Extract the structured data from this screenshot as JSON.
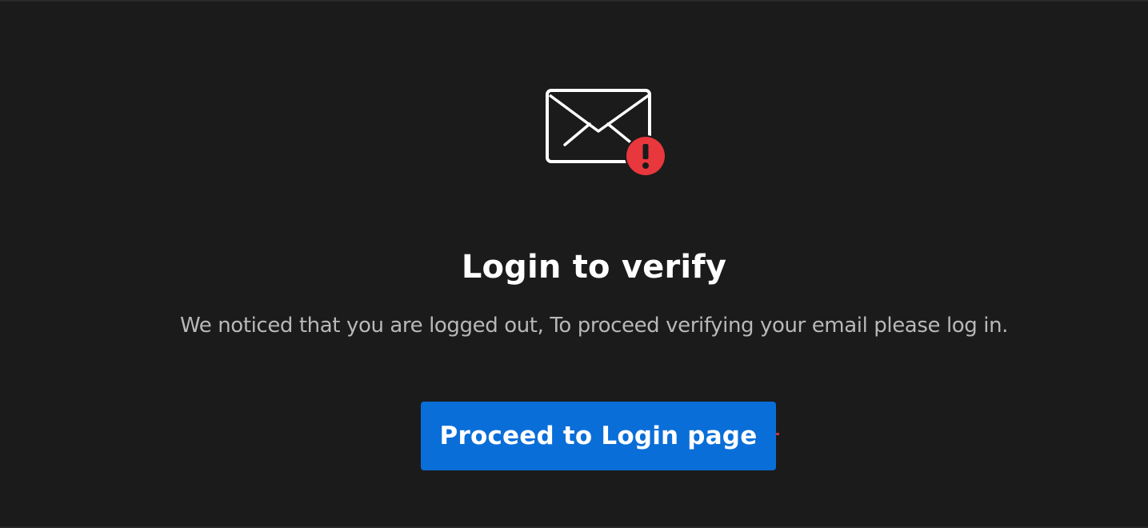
{
  "header_icon": {
    "name": "mail-alert-icon",
    "envelope_color": "#ffffff",
    "badge_color": "#e8373d",
    "badge_glyph": "!"
  },
  "content": {
    "title": "Login to verify",
    "message": "We noticed that you are logged out, To proceed verifying your email please log in.",
    "button_label": "Proceed to Login page"
  },
  "colors": {
    "background": "#1b1b1b",
    "title": "#ffffff",
    "message": "#b8b8b8",
    "button": "#0a6ed8",
    "button_text": "#ffffff"
  }
}
